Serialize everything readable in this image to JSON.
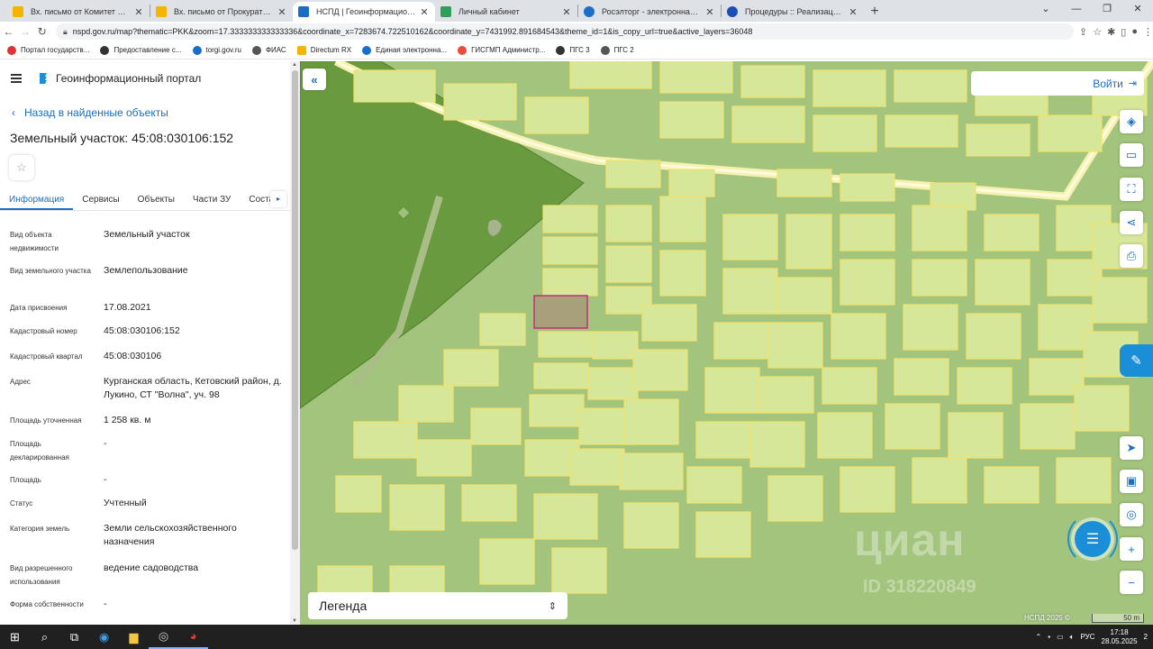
{
  "browser": {
    "tabs": [
      {
        "title": "Вх. письмо от Комитет по упра",
        "favicon_color": "#f4b400"
      },
      {
        "title": "Вх. письмо от Прокуратура Кет",
        "favicon_color": "#f4b400"
      },
      {
        "title": "НСПД | Геоинформационный п",
        "favicon_color": "#1a6ec7",
        "active": true
      },
      {
        "title": "Личный кабинет",
        "favicon_color": "#2e9f5a"
      },
      {
        "title": "Росэлторг - электронная торгов",
        "favicon_color": "#1a6ec7"
      },
      {
        "title": "Процедуры :: Реализация госим",
        "favicon_color": "#1a4fb8"
      }
    ],
    "url": "nspd.gov.ru/map?thematic=PKK&zoom=17.333333333333336&coordinate_x=7283674.722510162&coordinate_y=7431992.891684543&theme_id=1&is_copy_url=true&active_layers=36048",
    "bookmarks": [
      {
        "label": "Портал государств...",
        "color": "#d33"
      },
      {
        "label": "Предоставление с...",
        "color": "#333"
      },
      {
        "label": "torgi.gov.ru",
        "color": "#1a6ec7"
      },
      {
        "label": "ФИАС",
        "color": "#555"
      },
      {
        "label": "Directum RX",
        "color": "#f4b400"
      },
      {
        "label": "Единая электронна...",
        "color": "#1a6ec7"
      },
      {
        "label": "ГИСГМП Администр...",
        "color": "#e74c3c"
      },
      {
        "label": "ПГС 3",
        "color": "#333"
      },
      {
        "label": "ПГС 2",
        "color": "#555"
      }
    ]
  },
  "sidebar": {
    "portal_name": "Геоинформационный портал",
    "back_link": "Назад в найденные объекты",
    "title": "Земельный участок: 45:08:030106:152",
    "tabs": [
      "Информация",
      "Сервисы",
      "Объекты",
      "Части ЗУ",
      "Соста"
    ],
    "properties": [
      {
        "label": "Вид объекта недвижимости",
        "value": "Земельный участок"
      },
      {
        "label": "Вид земельного участка",
        "value": "Землепользование"
      },
      {
        "label": "Дата присвоения",
        "value": "17.08.2021"
      },
      {
        "label": "Кадастровый номер",
        "value": "45:08:030106:152"
      },
      {
        "label": "Кадастровый квартал",
        "value": "45:08:030106"
      },
      {
        "label": "Адрес",
        "value": "Курганская область, Кетовский район, д. Лукино, СТ \"Волна\", уч. 98"
      },
      {
        "label": "Площадь уточненная",
        "value": "1 258 кв. м"
      },
      {
        "label": "Площадь декларированная",
        "value": "-"
      },
      {
        "label": "Площадь",
        "value": "-"
      },
      {
        "label": "Статус",
        "value": "Учтенный"
      },
      {
        "label": "Категория земель",
        "value": "Земли сельскохозяйственного назначения"
      },
      {
        "label": "Вид разрешенного использования",
        "value": "ведение садоводства"
      },
      {
        "label": "Форма собственности",
        "value": "-"
      }
    ]
  },
  "map": {
    "login_label": "Войти",
    "legend_label": "Легенда",
    "copyright": "НСПД 2025 ©",
    "scale_label": "50 m",
    "watermark": "циан",
    "watermark_id": "ID 318220849",
    "colors": {
      "base": "#a3c47c",
      "parcel": "#d6e79a",
      "parcel_border": "#f4e26a",
      "forest": "#6a9a3f",
      "selected": "#a8a07a",
      "selected_border": "#c0307a"
    }
  },
  "taskbar": {
    "lang": "РУС",
    "time": "17:18",
    "date": "28.05.2025",
    "notif": "2"
  }
}
